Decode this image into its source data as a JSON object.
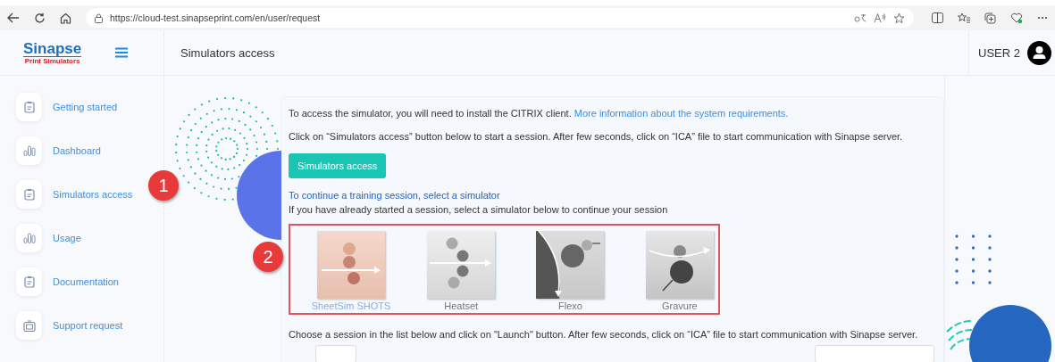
{
  "browser": {
    "url": "https://cloud-test.sinapseprint.com/en/user/request"
  },
  "header": {
    "logo_name": "Sinapse",
    "logo_tagline": "Print Simulators",
    "page_title": "Simulators access",
    "user_name": "USER 2"
  },
  "sidebar": {
    "items": [
      {
        "label": "Getting started",
        "kind": "clipboard"
      },
      {
        "label": "Dashboard",
        "kind": "chart"
      },
      {
        "label": "Simulators access",
        "kind": "clipboard"
      },
      {
        "label": "Usage",
        "kind": "chart"
      },
      {
        "label": "Documentation",
        "kind": "clipboard"
      },
      {
        "label": "Support request",
        "kind": "ticket"
      }
    ]
  },
  "content": {
    "intro": "To access the simulator, you will need to install the CITRIX client.",
    "intro_link": "More information about the system requirements.",
    "instruction": "Click on “Simulators access” button below to start a session. After few seconds, click on “ICA” file to start communication with Sinapse server.",
    "access_button": "Simulators access",
    "section_heading": "To continue a training session, select a simulator",
    "section_subtitle": "If you have already started a session, select a simulator below to continue your session",
    "simulators": [
      {
        "label": "SheetSim SHOTS",
        "kind": "sheetsim",
        "selected": true
      },
      {
        "label": "Heatset",
        "kind": "heatset",
        "selected": false
      },
      {
        "label": "Flexo",
        "kind": "flexo",
        "selected": false
      },
      {
        "label": "Gravure",
        "kind": "gravure",
        "selected": false
      }
    ],
    "footer_note": "Choose a session in the list below and click on \"Launch\" button. After few seconds, click on “ICA” file to start communication with Sinapse server."
  },
  "annotations": [
    {
      "label": "1"
    },
    {
      "label": "2"
    }
  ]
}
